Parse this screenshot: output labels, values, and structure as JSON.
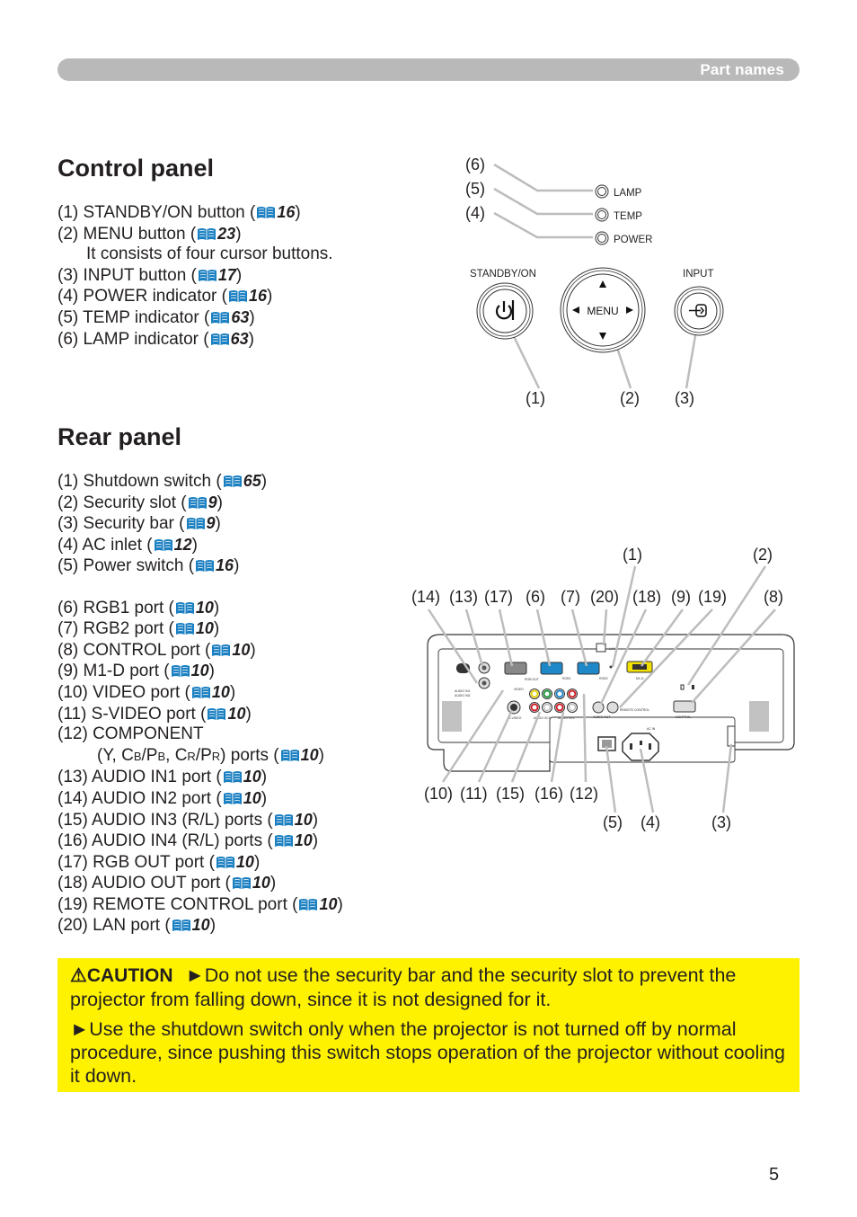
{
  "header": {
    "title": "Part names"
  },
  "control_panel": {
    "title": "Control panel",
    "items": [
      {
        "num": "(1)",
        "label": "STANDBY/ON button",
        "page": "16"
      },
      {
        "num": "(2)",
        "label": "MENU button",
        "page": "23",
        "note": "It consists of four cursor buttons."
      },
      {
        "num": "(3)",
        "label": "INPUT button",
        "page": "17"
      },
      {
        "num": "(4)",
        "label": "POWER indicator",
        "page": "16"
      },
      {
        "num": "(5)",
        "label": "TEMP indicator",
        "page": "63"
      },
      {
        "num": "(6)",
        "label": "LAMP indicator",
        "page": "63"
      }
    ],
    "diagram": {
      "indicators": [
        "LAMP",
        "TEMP",
        "POWER"
      ],
      "standby_label": "STANDBY/ON",
      "menu_label": "MENU",
      "input_label": "INPUT",
      "callouts": [
        "(6)",
        "(5)",
        "(4)",
        "(1)",
        "(2)",
        "(3)"
      ]
    }
  },
  "rear_panel": {
    "title": "Rear panel",
    "items": [
      {
        "num": "(1)",
        "label": "Shutdown switch",
        "page": "65"
      },
      {
        "num": "(2)",
        "label": "Security slot",
        "page": "9"
      },
      {
        "num": "(3)",
        "label": "Security bar",
        "page": "9"
      },
      {
        "num": "(4)",
        "label": "AC inlet",
        "page": "12"
      },
      {
        "num": "(5)",
        "label": "Power switch",
        "page": "16"
      },
      {
        "num": "(6)",
        "label": "RGB1 port",
        "page": "10"
      },
      {
        "num": "(7)",
        "label": "RGB2 port",
        "page": "10"
      },
      {
        "num": "(8)",
        "label": "CONTROL port",
        "page": "10"
      },
      {
        "num": "(9)",
        "label": "M1-D port",
        "page": "10"
      },
      {
        "num": "(10)",
        "label": "VIDEO port",
        "page": "10"
      },
      {
        "num": "(11)",
        "label": "S-VIDEO port",
        "page": "10"
      },
      {
        "num": "(12)",
        "label": "COMPONENT",
        "page": "10",
        "note_pre": "(Y, C",
        "note_b": "B",
        "note_mid1": "/P",
        "note_b2": "B",
        "note_mid2": ", C",
        "note_r": "R",
        "note_mid3": "/P",
        "note_r2": "R",
        "note_post": ") ports"
      },
      {
        "num": "(13)",
        "label": "AUDIO IN1 port",
        "page": "10"
      },
      {
        "num": "(14)",
        "label": "AUDIO IN2 port",
        "page": "10"
      },
      {
        "num": "(15)",
        "label": "AUDIO IN3 (R/L) ports",
        "page": "10"
      },
      {
        "num": "(16)",
        "label": "AUDIO IN4 (R/L) ports",
        "page": "10"
      },
      {
        "num": "(17)",
        "label": "RGB OUT port",
        "page": "10"
      },
      {
        "num": "(18)",
        "label": "AUDIO OUT port",
        "page": "10"
      },
      {
        "num": "(19)",
        "label": "REMOTE CONTROL port",
        "page": "10"
      },
      {
        "num": "(20)",
        "label": "LAN port",
        "page": "10"
      }
    ],
    "diagram": {
      "top_callouts": [
        "(1)",
        "(2)"
      ],
      "row_callouts": [
        "(14)",
        "(13)",
        "(17)",
        "(6)",
        "(7)",
        "(20)",
        "(18)",
        "(9)",
        "(19)",
        "(8)"
      ],
      "bottom_callouts": [
        "(10)",
        "(11)",
        "(15)",
        "(16)",
        "(12)"
      ],
      "lower_callouts": [
        "(5)",
        "(4)",
        "(3)"
      ],
      "port_labels": {
        "audio_in1": "AUDIO IN1",
        "audio_in2": "AUDIO IN2",
        "rgb_out": "RGB OUT",
        "rgb1": "RGB1",
        "rgb2": "RGB2",
        "lan": "LAN",
        "m1d": "M1-D",
        "video": "VIDEO",
        "svideo": "S-VIDEO",
        "audio_in3": "AUDIO IN 3",
        "audio_in4": "AUDIO IN 4",
        "audio_out": "AUDIO OUT",
        "remote": "REMOTE CONTROL",
        "control": "CONTROL",
        "ac_in": "AC IN"
      }
    }
  },
  "caution": {
    "label": "CAUTION",
    "icon": "warning-triangle-icon",
    "paragraphs": [
      "Do not use the security bar and the security slot to prevent the projector from falling down, since it is not designed for it.",
      "Use the shutdown switch only when the projector is not turned off by normal procedure, since pushing this switch stops operation of the projector without cooling it down."
    ],
    "bg_color": "#fff200"
  },
  "page_number": "5",
  "colors": {
    "header_bar": "#b9b9b9",
    "book_icon": "#1a7fc1",
    "leader_line": "#bdbdbd"
  }
}
